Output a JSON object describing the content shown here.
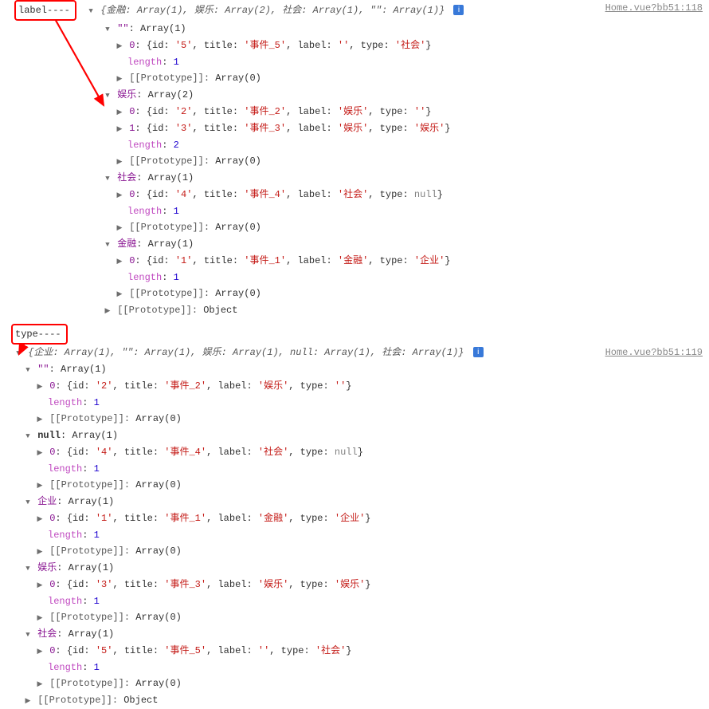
{
  "source1": "Home.vue?bb51:118",
  "source2": "Home.vue?bb51:119",
  "box1_label": "label----",
  "box2_label": "type----",
  "info_glyph": "i",
  "tri_down": "▼",
  "tri_right": "▶",
  "section1": {
    "summary_prefix": "{金融: Array(1), 娱乐: Array(2), 社会: Array(1), \"\": Array(1)}",
    "groups": [
      {
        "key": "\"\"",
        "arr": "Array(1)",
        "items": [
          {
            "idx": "0",
            "id": "'5'",
            "title": "'事件_5'",
            "label": "''",
            "type": "'社会'",
            "type_is_str": true
          }
        ],
        "length": "1",
        "proto": "Array(0)"
      },
      {
        "key": "娱乐",
        "arr": "Array(2)",
        "items": [
          {
            "idx": "0",
            "id": "'2'",
            "title": "'事件_2'",
            "label": "'娱乐'",
            "type": "''",
            "type_is_str": true
          },
          {
            "idx": "1",
            "id": "'3'",
            "title": "'事件_3'",
            "label": "'娱乐'",
            "type": "'娱乐'",
            "type_is_str": true
          }
        ],
        "length": "2",
        "proto": "Array(0)"
      },
      {
        "key": "社会",
        "arr": "Array(1)",
        "items": [
          {
            "idx": "0",
            "id": "'4'",
            "title": "'事件_4'",
            "label": "'社会'",
            "type": "null",
            "type_is_str": false
          }
        ],
        "length": "1",
        "proto": "Array(0)"
      },
      {
        "key": "金融",
        "arr": "Array(1)",
        "items": [
          {
            "idx": "0",
            "id": "'1'",
            "title": "'事件_1'",
            "label": "'金融'",
            "type": "'企业'",
            "type_is_str": true
          }
        ],
        "length": "1",
        "proto": "Array(0)"
      }
    ],
    "obj_proto": "Object"
  },
  "section2": {
    "summary_prefix": "{企业: Array(1), \"\": Array(1), 娱乐: Array(1), null: Array(1), 社会: Array(1)}",
    "groups": [
      {
        "key": "\"\"",
        "arr": "Array(1)",
        "items": [
          {
            "idx": "0",
            "id": "'2'",
            "title": "'事件_2'",
            "label": "'娱乐'",
            "type": "''",
            "type_is_str": true
          }
        ],
        "length": "1",
        "proto": "Array(0)"
      },
      {
        "key": "null",
        "arr": "Array(1)",
        "key_is_null": true,
        "items": [
          {
            "idx": "0",
            "id": "'4'",
            "title": "'事件_4'",
            "label": "'社会'",
            "type": "null",
            "type_is_str": false
          }
        ],
        "length": "1",
        "proto": "Array(0)"
      },
      {
        "key": "企业",
        "arr": "Array(1)",
        "items": [
          {
            "idx": "0",
            "id": "'1'",
            "title": "'事件_1'",
            "label": "'金融'",
            "type": "'企业'",
            "type_is_str": true
          }
        ],
        "length": "1",
        "proto": "Array(0)"
      },
      {
        "key": "娱乐",
        "arr": "Array(1)",
        "items": [
          {
            "idx": "0",
            "id": "'3'",
            "title": "'事件_3'",
            "label": "'娱乐'",
            "type": "'娱乐'",
            "type_is_str": true
          }
        ],
        "length": "1",
        "proto": "Array(0)"
      },
      {
        "key": "社会",
        "arr": "Array(1)",
        "items": [
          {
            "idx": "0",
            "id": "'5'",
            "title": "'事件_5'",
            "label": "''",
            "type": "'社会'",
            "type_is_str": true
          }
        ],
        "length": "1",
        "proto": "Array(0)"
      }
    ],
    "obj_proto": "Object"
  },
  "labels": {
    "id": "id",
    "title": "title",
    "label": "label",
    "type": "type",
    "length": "length",
    "proto": "[[Prototype]]"
  }
}
